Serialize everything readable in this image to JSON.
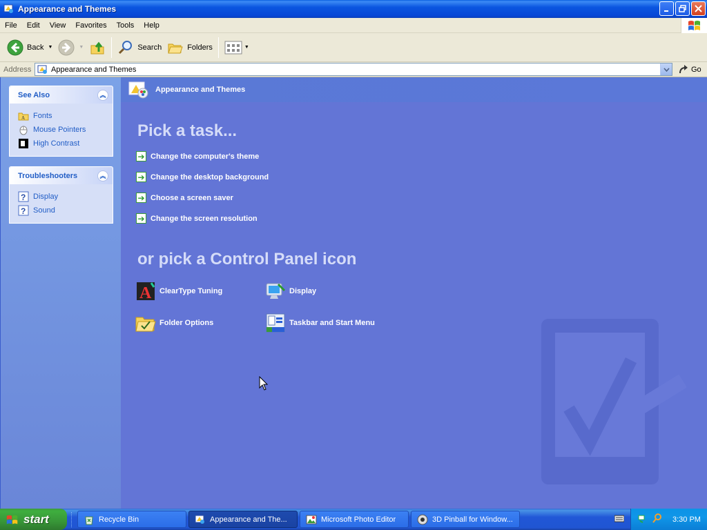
{
  "window": {
    "title": "Appearance and Themes"
  },
  "menu": [
    "File",
    "Edit",
    "View",
    "Favorites",
    "Tools",
    "Help"
  ],
  "toolbar": {
    "back_label": "Back",
    "search_label": "Search",
    "folders_label": "Folders"
  },
  "address": {
    "label": "Address",
    "value": "Appearance and Themes",
    "go_label": "Go"
  },
  "sidebar": {
    "see_also": {
      "header": "See Also",
      "items": [
        {
          "label": "Fonts",
          "icon": "folder-fonts-icon"
        },
        {
          "label": "Mouse Pointers",
          "icon": "mouse-icon"
        },
        {
          "label": "High Contrast",
          "icon": "high-contrast-icon"
        }
      ]
    },
    "troubleshooters": {
      "header": "Troubleshooters",
      "items": [
        {
          "label": "Display",
          "icon": "help-icon"
        },
        {
          "label": "Sound",
          "icon": "help-icon"
        }
      ]
    }
  },
  "main": {
    "header_title": "Appearance and Themes",
    "pick_task_title": "Pick a task...",
    "tasks": [
      "Change the computer's theme",
      "Change the desktop background",
      "Choose a screen saver",
      "Change the screen resolution"
    ],
    "or_pick_title": "or pick a Control Panel icon",
    "icons": [
      {
        "label": "ClearType Tuning",
        "icon": "cleartype-icon"
      },
      {
        "label": "Display",
        "icon": "display-icon"
      },
      {
        "label": "Folder Options",
        "icon": "folder-options-icon"
      },
      {
        "label": "Taskbar and Start Menu",
        "icon": "taskbar-icon"
      }
    ]
  },
  "taskbar": {
    "start_label": "start",
    "tasks": [
      {
        "label": "Recycle Bin",
        "active": false
      },
      {
        "label": "Appearance and The...",
        "active": true
      },
      {
        "label": "Microsoft Photo Editor",
        "active": false
      },
      {
        "label": "3D Pinball for Window...",
        "active": false
      }
    ],
    "clock": "3:30 PM"
  },
  "colors": {
    "title_blue": "#0a5fe0",
    "main_bg": "#6375d6",
    "sidebar_link": "#215dc6",
    "start_green": "#3c9a3c"
  }
}
